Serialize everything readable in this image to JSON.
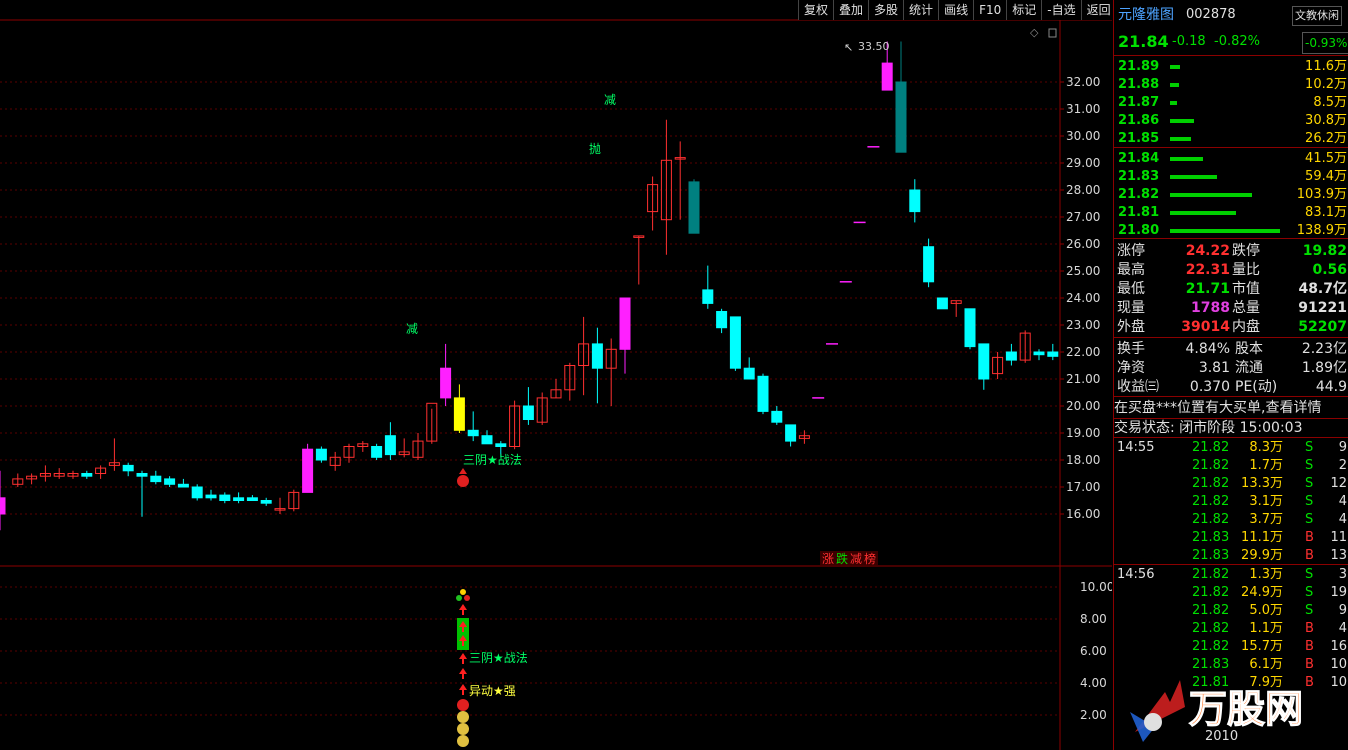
{
  "toolbar": [
    "复权",
    "叠加",
    "多股",
    "统计",
    "画线",
    "F10",
    "标记",
    "-自选",
    "返回"
  ],
  "stock": {
    "name": "元隆雅图",
    "code": "002878",
    "tag": "文教休闲",
    "price": "21.84",
    "change": "-0.18",
    "pct": "-0.82%",
    "sector_pct": "-0.93%"
  },
  "book": [
    {
      "p": "21.89",
      "v": "11.6万",
      "w": 10
    },
    {
      "p": "21.88",
      "v": "10.2万",
      "w": 9
    },
    {
      "p": "21.87",
      "v": "8.5万",
      "w": 7
    },
    {
      "p": "21.86",
      "v": "30.8万",
      "w": 24
    },
    {
      "p": "21.85",
      "v": "26.2万",
      "w": 21
    },
    {
      "p": "21.84",
      "v": "41.5万",
      "w": 33
    },
    {
      "p": "21.83",
      "v": "59.4万",
      "w": 47
    },
    {
      "p": "21.82",
      "v": "103.9万",
      "w": 82
    },
    {
      "p": "21.81",
      "v": "83.1万",
      "w": 66
    },
    {
      "p": "21.80",
      "v": "138.9万",
      "w": 110
    }
  ],
  "stats": [
    {
      "l1": "涨停",
      "v1": "24.22",
      "c1": "r",
      "l2": "跌停",
      "v2": "19.82",
      "c2": "g"
    },
    {
      "l1": "最高",
      "v1": "22.31",
      "c1": "r",
      "l2": "量比",
      "v2": "0.56",
      "c2": "g"
    },
    {
      "l1": "最低",
      "v1": "21.71",
      "c1": "g",
      "l2": "市值",
      "v2": "48.7亿",
      "c2": "w"
    },
    {
      "l1": "现量",
      "v1": "1788",
      "c1": "m",
      "l2": "总量",
      "v2": "91221",
      "c2": "w"
    },
    {
      "l1": "外盘",
      "v1": "39014",
      "c1": "r",
      "l2": "内盘",
      "v2": "52207",
      "c2": "g"
    }
  ],
  "stats2": [
    {
      "l1": "换手",
      "v1": "4.84%",
      "l2": "股本",
      "v2": "2.23亿"
    },
    {
      "l1": "净资",
      "v1": "3.81",
      "l2": "流通",
      "v2": "1.89亿"
    },
    {
      "l1": "收益㈢",
      "v1": "0.370",
      "l2": "PE(动)",
      "v2": "44.9"
    }
  ],
  "notice": "在买盘***位置有大买单,查看详情",
  "status": "交易状态: 闭市阶段 15:00:03",
  "ticks1": {
    "time": "14:55",
    "rows": [
      {
        "p": "21.82",
        "v": "8.3万",
        "d": "S",
        "n": "9"
      },
      {
        "p": "21.82",
        "v": "1.7万",
        "d": "S",
        "n": "2"
      },
      {
        "p": "21.82",
        "v": "13.3万",
        "d": "S",
        "n": "12"
      },
      {
        "p": "21.82",
        "v": "3.1万",
        "d": "S",
        "n": "4"
      },
      {
        "p": "21.82",
        "v": "3.7万",
        "d": "S",
        "n": "4"
      },
      {
        "p": "21.83",
        "v": "11.1万",
        "d": "B",
        "n": "11"
      },
      {
        "p": "21.83",
        "v": "29.9万",
        "d": "B",
        "n": "13"
      }
    ]
  },
  "ticks2": {
    "time": "14:56",
    "rows": [
      {
        "p": "21.82",
        "v": "1.3万",
        "d": "S",
        "n": "3"
      },
      {
        "p": "21.82",
        "v": "24.9万",
        "d": "S",
        "n": "19"
      },
      {
        "p": "21.82",
        "v": "5.0万",
        "d": "S",
        "n": "9"
      },
      {
        "p": "21.82",
        "v": "1.1万",
        "d": "B",
        "n": "4"
      },
      {
        "p": "21.82",
        "v": "15.7万",
        "d": "B",
        "n": "16"
      },
      {
        "p": "21.83",
        "v": "6.1万",
        "d": "B",
        "n": "10"
      },
      {
        "p": "21.81",
        "v": "7.9万",
        "d": "B",
        "n": "10"
      }
    ]
  },
  "chart_data": {
    "type": "candlestick",
    "price_axis": [
      32.0,
      31.0,
      30.0,
      29.0,
      28.0,
      27.0,
      26.0,
      25.0,
      24.0,
      23.0,
      22.0,
      21.0,
      20.0,
      19.0,
      18.0,
      17.0,
      16.0
    ],
    "indicator_axis": [
      10.0,
      8.0,
      6.0,
      4.0,
      2.0
    ],
    "high_label": "33.50",
    "annotations": [
      "减",
      "抛",
      "减",
      "三阴★战法",
      "三阴★战法",
      "异动★强",
      "涨跌减榜"
    ],
    "ohlc": [
      [
        16.0,
        17.6,
        15.4,
        16.6
      ],
      [
        17.1,
        17.5,
        17.0,
        17.3
      ],
      [
        17.3,
        17.5,
        17.1,
        17.4
      ],
      [
        17.4,
        17.8,
        17.2,
        17.5
      ],
      [
        17.4,
        17.7,
        17.3,
        17.5
      ],
      [
        17.4,
        17.6,
        17.3,
        17.5
      ],
      [
        17.5,
        17.6,
        17.3,
        17.4
      ],
      [
        17.5,
        17.8,
        17.3,
        17.7
      ],
      [
        17.8,
        18.8,
        17.6,
        17.9
      ],
      [
        17.8,
        17.9,
        17.4,
        17.6
      ],
      [
        17.5,
        17.6,
        15.9,
        17.4
      ],
      [
        17.4,
        17.6,
        17.1,
        17.2
      ],
      [
        17.3,
        17.4,
        17.0,
        17.1
      ],
      [
        17.1,
        17.3,
        17.0,
        17.0
      ],
      [
        17.0,
        17.1,
        16.5,
        16.6
      ],
      [
        16.7,
        16.9,
        16.5,
        16.6
      ],
      [
        16.7,
        16.8,
        16.4,
        16.5
      ],
      [
        16.6,
        16.8,
        16.4,
        16.5
      ],
      [
        16.6,
        16.7,
        16.5,
        16.5
      ],
      [
        16.5,
        16.6,
        16.3,
        16.4
      ],
      [
        16.2,
        16.6,
        16.0,
        16.2
      ],
      [
        16.2,
        16.9,
        16.1,
        16.8
      ],
      [
        16.8,
        18.6,
        16.8,
        18.4
      ],
      [
        18.4,
        18.5,
        17.9,
        18.0
      ],
      [
        17.8,
        18.3,
        17.6,
        18.1
      ],
      [
        18.1,
        18.6,
        17.9,
        18.5
      ],
      [
        18.5,
        18.7,
        18.3,
        18.6
      ],
      [
        18.5,
        18.6,
        18.0,
        18.1
      ],
      [
        18.9,
        19.4,
        18.0,
        18.2
      ],
      [
        18.2,
        18.8,
        18.1,
        18.3
      ],
      [
        18.1,
        19.0,
        18.0,
        18.7
      ],
      [
        18.7,
        19.9,
        18.6,
        20.1
      ],
      [
        21.4,
        22.3,
        20.0,
        20.3
      ],
      [
        20.3,
        20.8,
        19.0,
        19.1
      ],
      [
        19.1,
        19.8,
        18.7,
        18.9
      ],
      [
        18.9,
        19.1,
        18.7,
        18.6
      ],
      [
        18.6,
        18.7,
        18.1,
        18.5
      ],
      [
        18.5,
        20.2,
        18.4,
        20.0
      ],
      [
        20.0,
        20.7,
        19.3,
        19.5
      ],
      [
        19.4,
        20.5,
        19.3,
        20.3
      ],
      [
        20.3,
        21.0,
        20.3,
        20.6
      ],
      [
        20.6,
        21.6,
        20.2,
        21.5
      ],
      [
        21.5,
        23.3,
        20.4,
        22.3
      ],
      [
        22.3,
        22.9,
        20.1,
        21.4
      ],
      [
        21.4,
        22.5,
        20.0,
        22.1
      ],
      [
        22.1,
        24.0,
        21.2,
        24.0
      ],
      [
        26.3,
        26.3,
        24.5,
        26.3
      ],
      [
        27.2,
        28.5,
        26.5,
        28.2
      ],
      [
        26.9,
        30.6,
        25.6,
        29.1
      ],
      [
        29.2,
        29.8,
        26.9,
        29.2
      ],
      [
        28.3,
        28.4,
        26.4,
        26.4
      ],
      [
        24.3,
        25.2,
        23.6,
        23.8
      ],
      [
        23.5,
        23.6,
        22.7,
        22.9
      ],
      [
        23.3,
        23.3,
        21.3,
        21.4
      ],
      [
        21.4,
        21.8,
        21.0,
        21.0
      ],
      [
        21.1,
        21.2,
        19.7,
        19.8
      ],
      [
        19.8,
        20.0,
        19.3,
        19.4
      ],
      [
        19.3,
        19.3,
        18.5,
        18.7
      ],
      [
        18.8,
        19.1,
        18.6,
        18.9
      ],
      [
        20.3,
        20.3,
        20.3,
        20.3
      ],
      [
        22.3,
        22.3,
        22.3,
        22.3
      ],
      [
        24.6,
        24.6,
        24.6,
        24.6
      ],
      [
        26.8,
        26.8,
        26.8,
        26.8
      ],
      [
        29.6,
        29.6,
        29.6,
        29.6
      ],
      [
        31.7,
        33.5,
        31.7,
        32.7
      ],
      [
        32.0,
        33.5,
        29.4,
        29.4
      ],
      [
        28.0,
        28.4,
        26.8,
        27.2
      ],
      [
        25.9,
        26.2,
        24.4,
        24.6
      ],
      [
        24.0,
        24.0,
        23.6,
        23.6
      ],
      [
        23.8,
        23.9,
        23.3,
        23.9
      ],
      [
        23.6,
        23.6,
        22.1,
        22.2
      ],
      [
        22.3,
        22.3,
        20.6,
        21.0
      ],
      [
        21.2,
        22.0,
        21.0,
        21.8
      ],
      [
        22.0,
        22.3,
        21.5,
        21.7
      ],
      [
        21.7,
        22.8,
        21.6,
        22.7
      ],
      [
        22.0,
        22.1,
        21.7,
        21.9
      ],
      [
        22.0,
        22.3,
        21.7,
        21.84
      ]
    ]
  }
}
